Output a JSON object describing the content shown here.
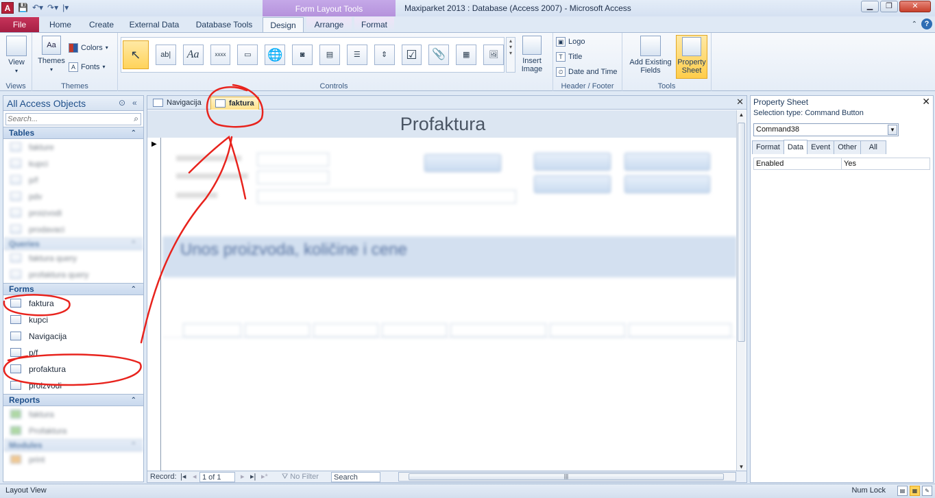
{
  "window": {
    "app_icon_letter": "A",
    "context_group": "Form Layout Tools",
    "title": "Maxiparket 2013 : Database (Access 2007)  -  Microsoft Access"
  },
  "ribbon_tabs": [
    "File",
    "Home",
    "Create",
    "External Data",
    "Database Tools",
    "Design",
    "Arrange",
    "Format"
  ],
  "ribbon": {
    "views": {
      "view_label": "View",
      "group": "Views"
    },
    "themes": {
      "themes_label": "Themes",
      "colors_label": "Colors",
      "fonts_label": "Fonts",
      "group": "Themes"
    },
    "controls": {
      "group": "Controls",
      "insert_image": "Insert Image",
      "textbox_glyph": "ab|",
      "label_glyph": "Aa",
      "button_glyph": "xxxx"
    },
    "header_footer": {
      "logo": "Logo",
      "title": "Title",
      "date_time": "Date and Time",
      "group": "Header / Footer"
    },
    "tools": {
      "add_fields": "Add Existing Fields",
      "property_sheet": "Property Sheet",
      "group": "Tools"
    }
  },
  "nav": {
    "title": "All Access Objects",
    "search_placeholder": "Search...",
    "sections": {
      "tables": "Tables",
      "queries": "Queries",
      "forms": "Forms",
      "reports": "Reports",
      "modules": "Modules"
    },
    "tables_items": [
      "fakture",
      "kupci",
      "p/f",
      "pdv",
      "proizvodi",
      "prodavaci"
    ],
    "queries_items": [
      "faktura query",
      "profaktura query"
    ],
    "forms_items": [
      "faktura",
      "kupci",
      "Navigacija",
      "p/f",
      "profaktura",
      "proizvodi"
    ],
    "reports_items": [
      "faktura",
      "Profaktura"
    ],
    "modules_items": [
      "print"
    ]
  },
  "document": {
    "tabs": [
      "Navigacija",
      "faktura"
    ],
    "form_title": "Profaktura",
    "subform_title": "Unos proizvoda, količine i cene",
    "record_nav": {
      "record_label": "Record:",
      "position": "1 of 1",
      "filter": "No Filter",
      "search": "Search"
    }
  },
  "property_sheet": {
    "title": "Property Sheet",
    "selection_type": "Selection type:  Command Button",
    "selected_control": "Command38",
    "tabs": [
      "Format",
      "Data",
      "Event",
      "Other",
      "All"
    ],
    "rows": [
      {
        "key": "Enabled",
        "value": "Yes"
      }
    ]
  },
  "status": {
    "view": "Layout View",
    "num_lock": "Num Lock"
  },
  "colors": {
    "annotation": "#e8231d",
    "file_tab": "#b52a4e",
    "active_doc_tab": "#ffe18a"
  }
}
